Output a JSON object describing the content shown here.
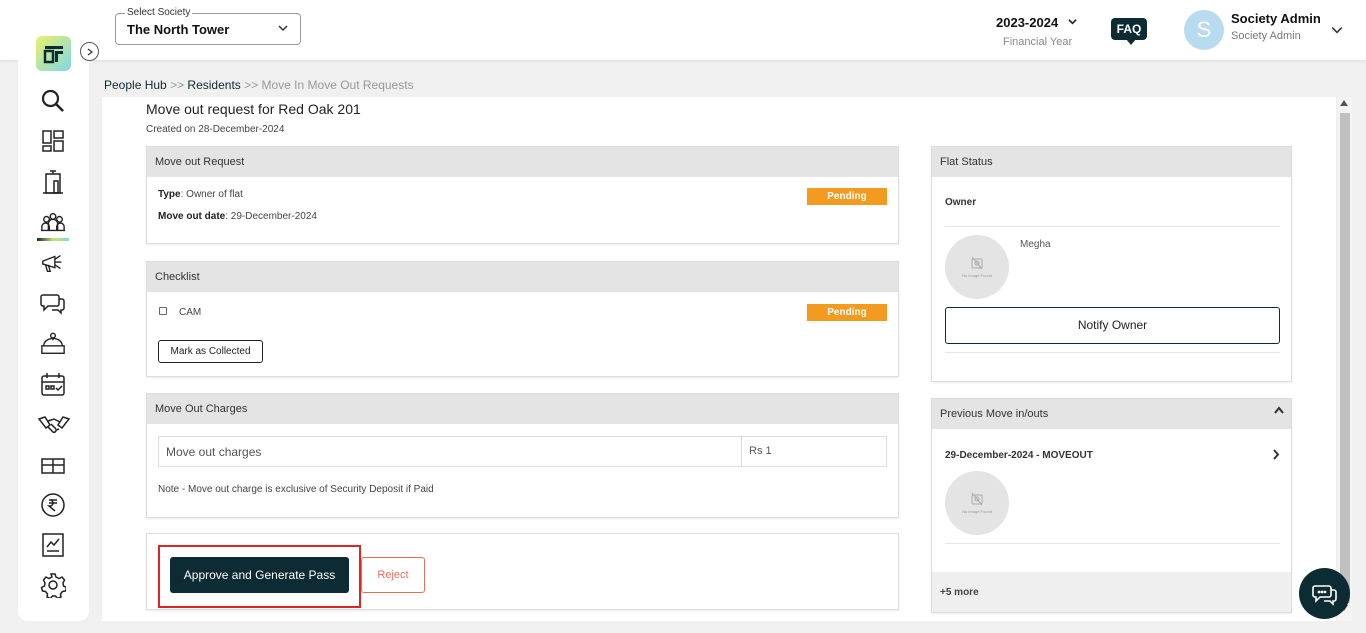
{
  "header": {
    "society_label": "Select Society",
    "society_value": "The North Tower",
    "financial_year": "2023-2024",
    "financial_year_label": "Financial Year",
    "faq_label": "FAQ",
    "avatar_initial": "S",
    "user_name": "Society Admin",
    "user_role": "Society Admin"
  },
  "sidebar": {
    "items": [
      "search-icon",
      "dashboard-icon",
      "building-icon",
      "people-icon",
      "megaphone-icon",
      "chat-icon",
      "services-icon",
      "calendar-icon",
      "handshake-icon",
      "gift-icon",
      "rupee-icon",
      "report-icon",
      "settings-icon"
    ],
    "active": "people-icon"
  },
  "breadcrumb": {
    "item1": "People Hub",
    "sep1": ">>",
    "item2": "Residents",
    "sep2": ">>",
    "current": "Move In Move Out Requests"
  },
  "request": {
    "title": "Move out request for Red Oak 201",
    "created": "Created on 28-December-2024"
  },
  "move_out_request": {
    "header": "Move out Request",
    "type_label": "Type",
    "type_value": ": Owner of flat",
    "date_label": "Move out date",
    "date_value": ": 29-December-2024",
    "status": "Pending"
  },
  "checklist": {
    "header": "Checklist",
    "item_label": "CAM",
    "item_status": "Pending",
    "collect_button": "Mark as Collected"
  },
  "charges": {
    "header": "Move Out Charges",
    "row_label": "Move out charges",
    "row_value": "Rs 1",
    "note": "Note - Move out charge is exclusive of Security Deposit if Paid"
  },
  "actions": {
    "approve": "Approve and Generate Pass",
    "reject": "Reject"
  },
  "flat_status": {
    "header": "Flat Status",
    "owner_label": "Owner",
    "owner_name": "Megha",
    "no_image": "No Image Found",
    "notify_button": "Notify Owner"
  },
  "previous": {
    "header": "Previous Move in/outs",
    "entry": "29-December-2024 - MOVEOUT",
    "no_image": "No Image Found",
    "more": "+5 more"
  },
  "colors": {
    "primary": "#0d2b33",
    "pending": "#f39b21",
    "reject": "#e2725b",
    "highlight": "#e02424"
  }
}
